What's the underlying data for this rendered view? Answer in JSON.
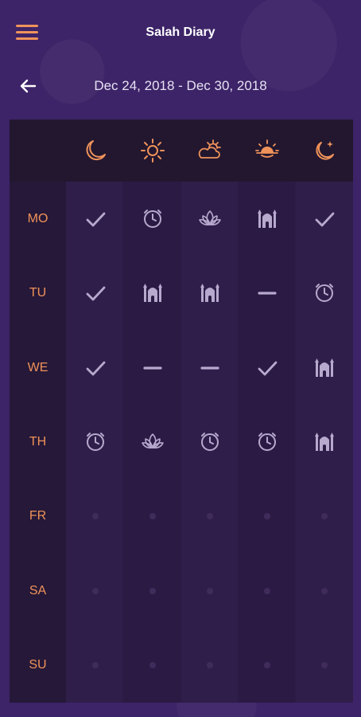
{
  "header": {
    "title": "Salah Diary",
    "week_range": "Dec 24, 2018 - Dec 30, 2018"
  },
  "colors": {
    "accent": "#f0935a",
    "status_icon": "#b6a9cd",
    "background": "#3d2468",
    "grid": "#2c1b45",
    "empty_dot": "#3f2c5a"
  },
  "prayers": [
    {
      "icon": "crescent-moon-icon"
    },
    {
      "icon": "sun-icon"
    },
    {
      "icon": "sun-behind-cloud-icon"
    },
    {
      "icon": "sunset-icon"
    },
    {
      "icon": "moon-star-icon"
    }
  ],
  "days": [
    {
      "label": "MO",
      "statuses": [
        "check",
        "clock",
        "lotus",
        "mosque",
        "check"
      ]
    },
    {
      "label": "TU",
      "statuses": [
        "check",
        "mosque",
        "mosque",
        "dash",
        "clock"
      ]
    },
    {
      "label": "WE",
      "statuses": [
        "check",
        "dash",
        "dash",
        "check",
        "mosque"
      ]
    },
    {
      "label": "TH",
      "statuses": [
        "clock",
        "lotus",
        "clock",
        "clock",
        "mosque"
      ]
    },
    {
      "label": "FR",
      "statuses": [
        "empty",
        "empty",
        "empty",
        "empty",
        "empty"
      ]
    },
    {
      "label": "SA",
      "statuses": [
        "empty",
        "empty",
        "empty",
        "empty",
        "empty"
      ]
    },
    {
      "label": "SU",
      "statuses": [
        "empty",
        "empty",
        "empty",
        "empty",
        "empty"
      ]
    }
  ]
}
